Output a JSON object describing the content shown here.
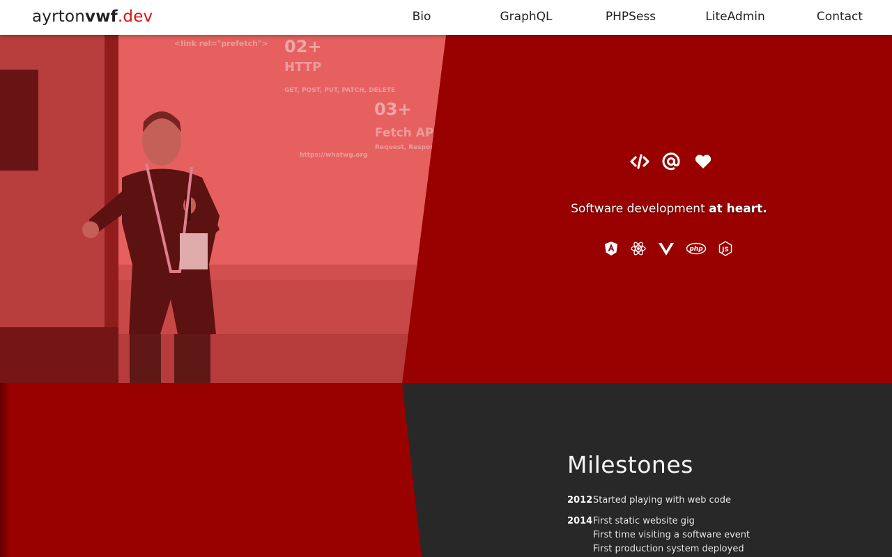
{
  "header": {
    "logo": {
      "part1": "ayrton",
      "part2": "vwf",
      "part3": ".dev"
    },
    "nav": [
      {
        "label": "Bio"
      },
      {
        "label": "GraphQL"
      },
      {
        "label": "PHPSess"
      },
      {
        "label": "LiteAdmin"
      },
      {
        "label": "Contact"
      }
    ]
  },
  "hero": {
    "photo_alt": "speaker-photo",
    "slide_text": [
      "<link rel=\"prefetch\">",
      "HTTP",
      "GET, POST, PUT, PATCH, DELETE",
      "Fetch API",
      "Request, Response, URLSearchParams",
      "https://whatwg.org"
    ],
    "icons": [
      "code-icon",
      "at-icon",
      "heart-icon"
    ],
    "tagline": {
      "normal": "Software development",
      "bold": "at heart."
    },
    "tech": [
      "angular-icon",
      "react-icon",
      "vue-icon",
      "php-icon",
      "nodejs-icon"
    ]
  },
  "milestones": {
    "title": "Milestones",
    "entries": [
      {
        "year": "2012",
        "items": [
          "Started playing with web code"
        ]
      },
      {
        "year": "2014",
        "items": [
          "First static website gig",
          "First time visiting a software event",
          "First production system deployed"
        ]
      }
    ]
  },
  "colors": {
    "brand_red": "#990000",
    "accent": "#d71414",
    "dark": "#282828"
  }
}
